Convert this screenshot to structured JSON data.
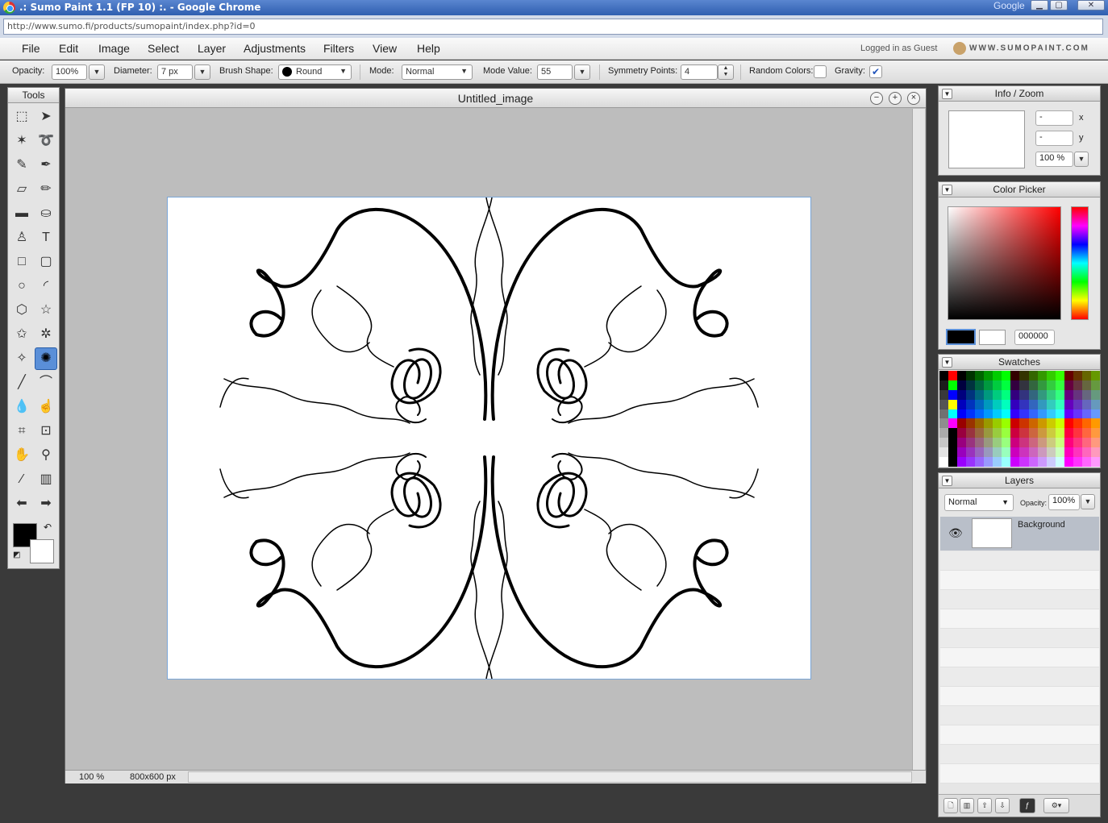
{
  "window": {
    "title": ".: Sumo Paint 1.1 (FP 10) :. - Google Chrome",
    "brand": "Google"
  },
  "address": {
    "url": "http://www.sumo.fi/products/sumopaint/index.php?id=0"
  },
  "menu": [
    "File",
    "Edit",
    "Image",
    "Select",
    "Layer",
    "Adjustments",
    "Filters",
    "View",
    "Help"
  ],
  "account": {
    "status": "Logged in as Guest",
    "site": "WWW.SUMOPAINT.COM"
  },
  "options": {
    "opacity_label": "Opacity:",
    "opacity": "100%",
    "diameter_label": "Diameter:",
    "diameter": "7 px",
    "brush_label": "Brush Shape:",
    "brush": "Round",
    "mode_label": "Mode:",
    "mode": "Normal",
    "mode_value_label": "Mode Value:",
    "mode_value": "55",
    "symmetry_label": "Symmetry Points:",
    "symmetry": "4",
    "random_label": "Random Colors:",
    "random_checked": false,
    "gravity_label": "Gravity:",
    "gravity_checked": true
  },
  "tools": {
    "title": "Tools",
    "items": [
      {
        "name": "marquee-tool-icon",
        "glyph": "⬚"
      },
      {
        "name": "move-tool-icon",
        "glyph": "➤"
      },
      {
        "name": "magic-wand-tool-icon",
        "glyph": "✶"
      },
      {
        "name": "lasso-tool-icon",
        "glyph": "➰"
      },
      {
        "name": "brush-tool-icon",
        "glyph": "✎"
      },
      {
        "name": "ink-tool-icon",
        "glyph": "✒"
      },
      {
        "name": "eraser-tool-icon",
        "glyph": "▱"
      },
      {
        "name": "pencil-tool-icon",
        "glyph": "✏"
      },
      {
        "name": "gradient-tool-icon",
        "glyph": "▬"
      },
      {
        "name": "fill-tool-icon",
        "glyph": "⛀"
      },
      {
        "name": "stamp-tool-icon",
        "glyph": "♙"
      },
      {
        "name": "text-tool-icon",
        "glyph": "T"
      },
      {
        "name": "rectangle-tool-icon",
        "glyph": "□"
      },
      {
        "name": "rounded-rect-tool-icon",
        "glyph": "▢"
      },
      {
        "name": "ellipse-tool-icon",
        "glyph": "○"
      },
      {
        "name": "arc-tool-icon",
        "glyph": "◜"
      },
      {
        "name": "polygon-tool-icon",
        "glyph": "⬡"
      },
      {
        "name": "star-tool-icon",
        "glyph": "☆"
      },
      {
        "name": "star-outline-tool-icon",
        "glyph": "✩"
      },
      {
        "name": "gear-shape-tool-icon",
        "glyph": "✲"
      },
      {
        "name": "custom-shape-tool-icon",
        "glyph": "✧"
      },
      {
        "name": "symmetry-tool-icon",
        "glyph": "✺"
      },
      {
        "name": "line-tool-icon",
        "glyph": "╱"
      },
      {
        "name": "curve-tool-icon",
        "glyph": "⌒"
      },
      {
        "name": "blur-tool-icon",
        "glyph": "💧"
      },
      {
        "name": "smudge-tool-icon",
        "glyph": "☝"
      },
      {
        "name": "crop-tool-icon",
        "glyph": "⌗"
      },
      {
        "name": "transform-tool-icon",
        "glyph": "⊡"
      },
      {
        "name": "hand-tool-icon",
        "glyph": "✋"
      },
      {
        "name": "zoom-tool-icon",
        "glyph": "⚲"
      },
      {
        "name": "eyedropper-tool-icon",
        "glyph": "⁄"
      },
      {
        "name": "trash-tool-icon",
        "glyph": "▥"
      },
      {
        "name": "undo-arrow-icon",
        "glyph": "⬅"
      },
      {
        "name": "redo-arrow-icon",
        "glyph": "➡"
      }
    ],
    "fg_color": "#000000",
    "bg_color": "#ffffff"
  },
  "document": {
    "title": "Untitled_image",
    "zoom": "100 %",
    "size": "800x600 px"
  },
  "info": {
    "title": "Info / Zoom",
    "x_value": "-",
    "x_label": "x",
    "y_value": "-",
    "y_label": "y",
    "zoom": "100 %"
  },
  "color_picker": {
    "title": "Color Picker",
    "hex": "000000"
  },
  "swatches": {
    "title": "Swatches"
  },
  "layers": {
    "title": "Layers",
    "mode": "Normal",
    "opacity_label": "Opacity:",
    "opacity": "100%",
    "items": [
      {
        "name": "Background"
      }
    ]
  }
}
